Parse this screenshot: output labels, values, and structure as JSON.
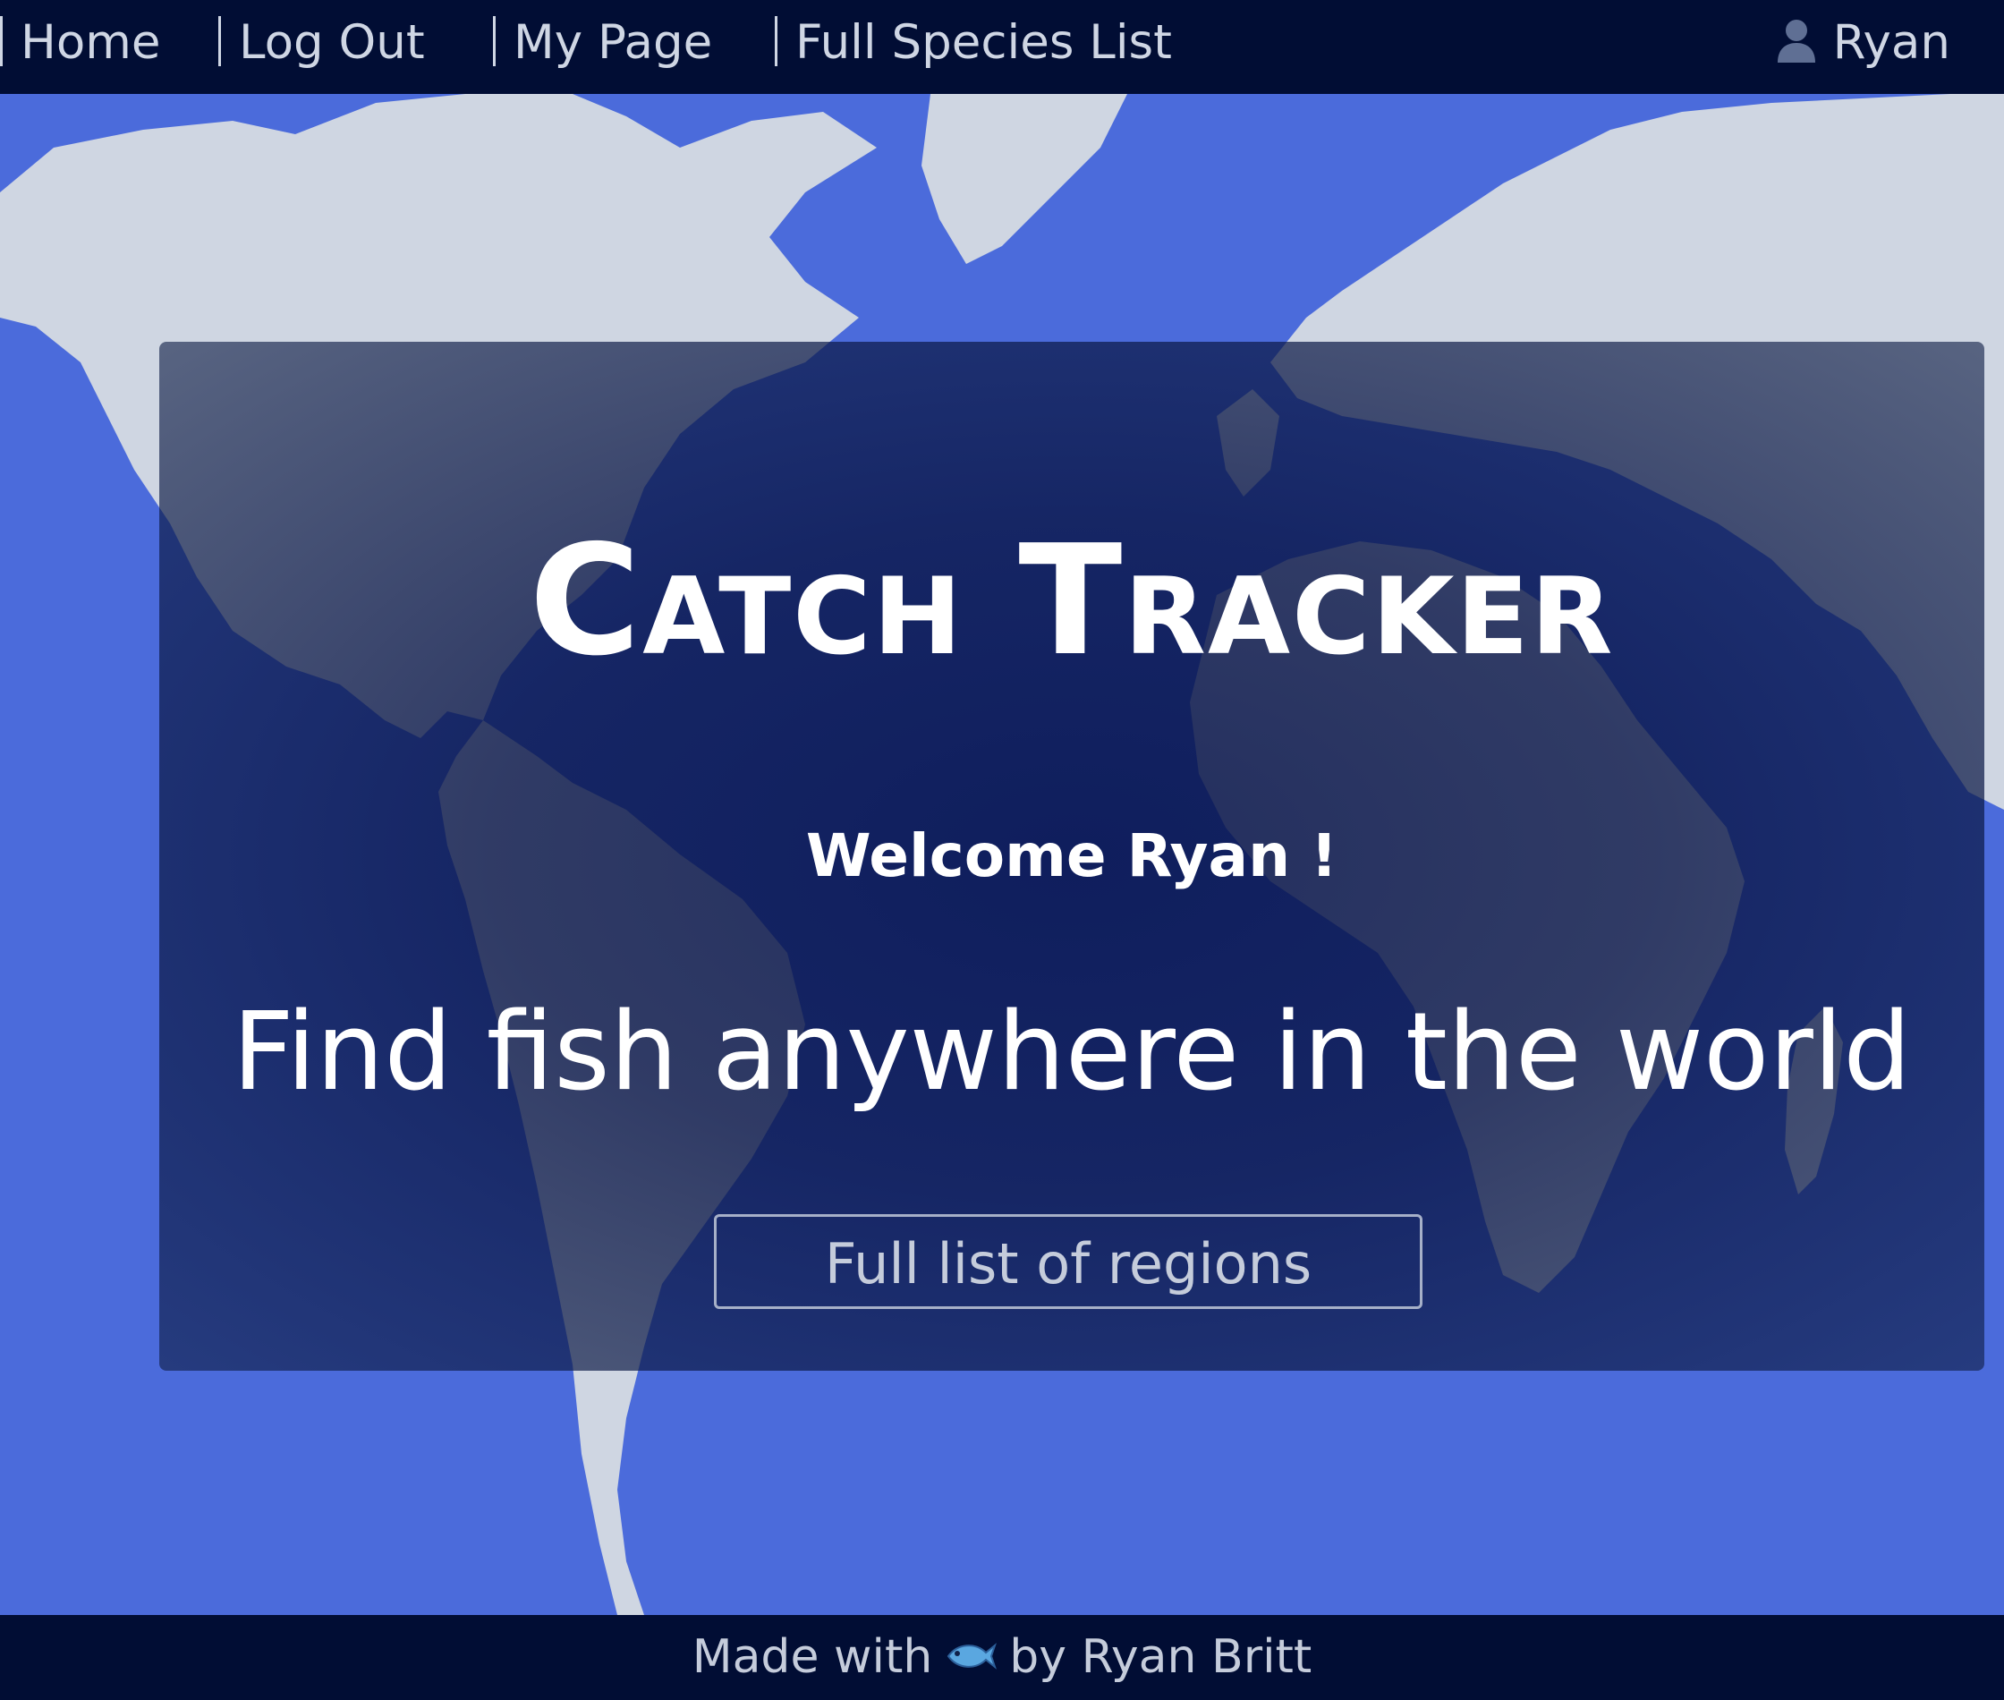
{
  "nav": {
    "links": [
      {
        "label": "Home"
      },
      {
        "label": "Log Out"
      },
      {
        "label": "My Page"
      },
      {
        "label": "Full Species List"
      }
    ],
    "user_icon": "user-icon",
    "user_name": "Ryan"
  },
  "hero": {
    "title": "Catch Tracker",
    "welcome": "Welcome Ryan !",
    "tagline": "Find fish anywhere in the world",
    "button_label": "Full list of regions"
  },
  "footer": {
    "made_with": "Made with",
    "icon": "fish-icon",
    "by": "by Ryan Britt"
  },
  "colors": {
    "navbar": "#010d34",
    "ocean": "#4b6bdb",
    "land": "#cfd6e2",
    "card_overlay": "#0a1a55",
    "text": "#ffffff"
  }
}
